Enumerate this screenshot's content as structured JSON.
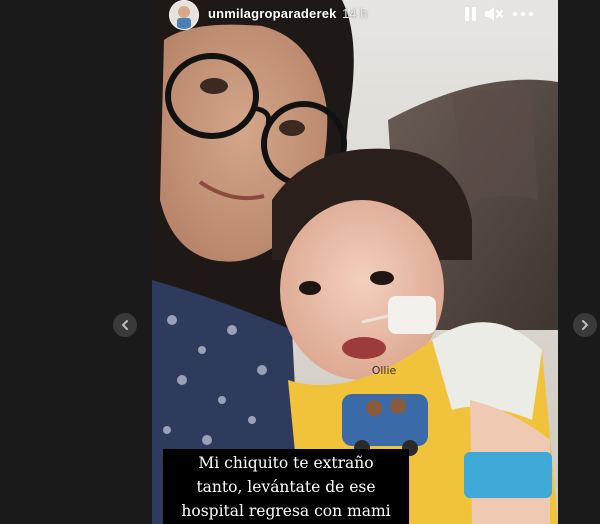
{
  "story": {
    "username": "unmilagroparaderek",
    "timestamp": "14 h",
    "caption": "Mi chiquito te extraño\ntanto, levántate de ese\nhospital regresa con mami",
    "shirt_text": "Ollie"
  },
  "controls": {
    "pause_icon": "pause-icon",
    "mute_icon": "speaker-muted-icon",
    "more_icon": "more-options-icon",
    "prev_icon": "chevron-left-icon",
    "next_icon": "chevron-right-icon"
  },
  "colors": {
    "background": "#1a1a1a",
    "caption_bg": "#000000",
    "caption_text": "#ffffff",
    "nav_button": "#3a3a3a"
  }
}
